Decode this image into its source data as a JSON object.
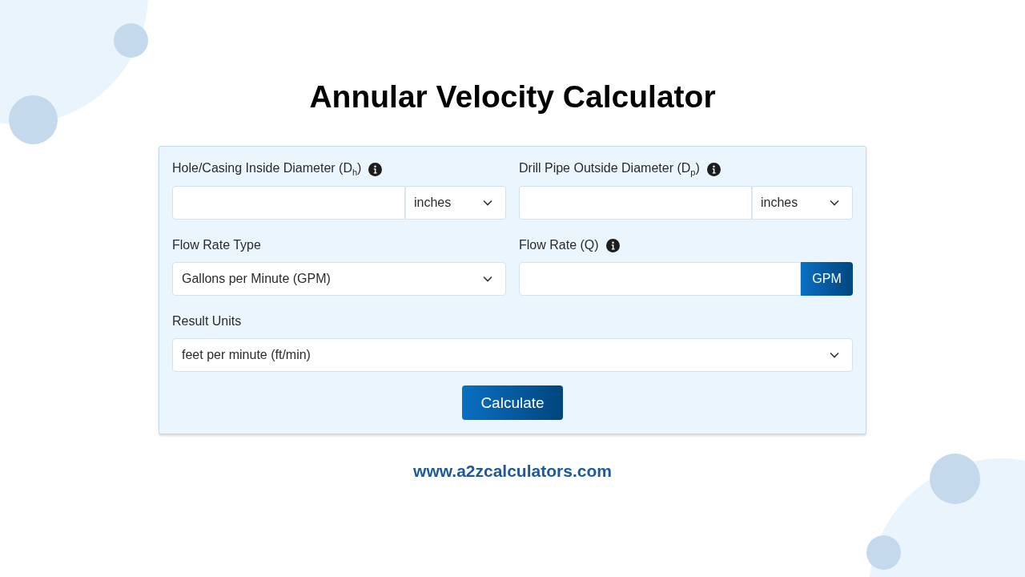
{
  "title": "Annular Velocity Calculator",
  "fields": [
    {
      "kind": "input_select",
      "label": "Hole/Casing Inside Diameter (D$_{h}$)",
      "info": true,
      "wide": false,
      "unit": "inches"
    },
    {
      "kind": "input_select",
      "label": "Drill Pipe Outside Diameter (D$_{p}$)",
      "info": true,
      "wide": false,
      "unit": "inches"
    },
    {
      "kind": "select",
      "label": "Flow Rate Type",
      "info": false,
      "wide": false,
      "value": "Gallons per Minute (GPM)"
    },
    {
      "kind": "input_addon",
      "label": "Flow Rate (Q)",
      "info": true,
      "wide": false,
      "unit": "GPM"
    },
    {
      "kind": "select",
      "label": "Result Units",
      "info": false,
      "wide": true,
      "value": "feet per minute (ft/min)"
    }
  ],
  "calculate_button": "Calculate",
  "footer": "www.a2zcalculators.com"
}
